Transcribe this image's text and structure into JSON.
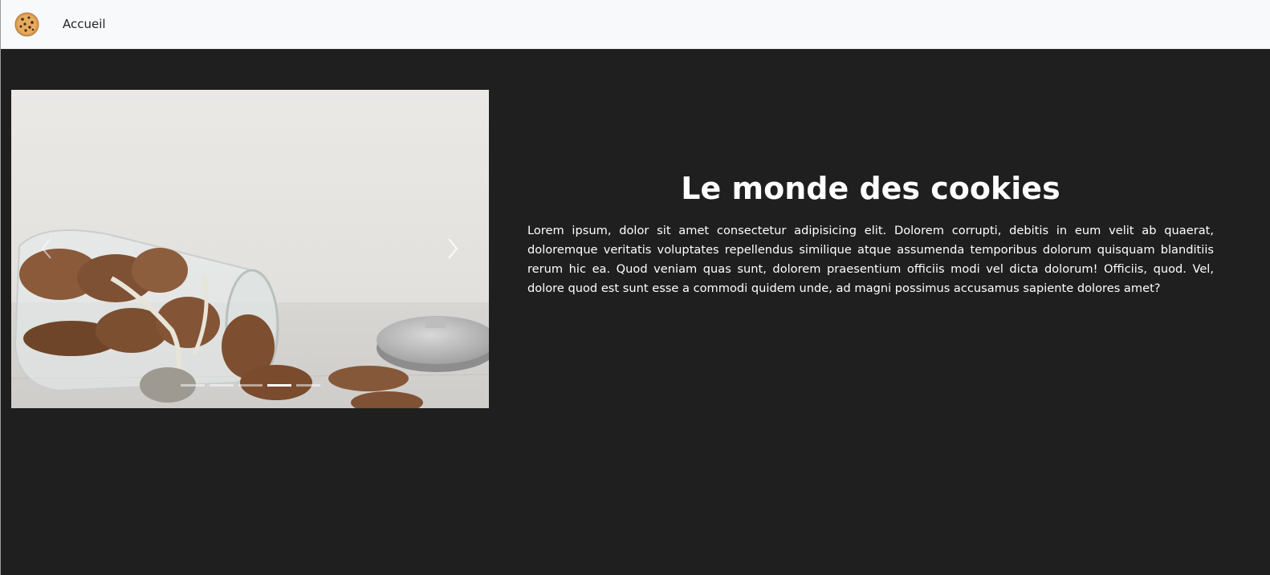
{
  "navbar": {
    "brand_icon": "cookie-icon",
    "links": [
      {
        "label": "Accueil"
      }
    ]
  },
  "carousel": {
    "image": "cookies-in-glass-jar",
    "prev_icon": "chevron-left-icon",
    "next_icon": "chevron-right-icon",
    "slide_count": 5,
    "active_index": 3
  },
  "main": {
    "title": "Le monde des cookies",
    "paragraph": "Lorem ipsum, dolor sit amet consectetur adipisicing elit. Dolorem corrupti, debitis in eum velit ab quaerat, doloremque veritatis voluptates repellendus similique atque assumenda temporibus dolorum quisquam blanditiis rerum hic ea. Quod veniam quas sunt, dolorem praesentium officiis modi vel dicta dolorum! Officiis, quod. Vel, dolore quod est sunt esse a commodi quidem unde, ad magni possimus accusamus sapiente dolores amet?"
  },
  "colors": {
    "background": "#1f1f1f",
    "navbar_background": "#f8f9fa",
    "text": "#ffffff"
  }
}
